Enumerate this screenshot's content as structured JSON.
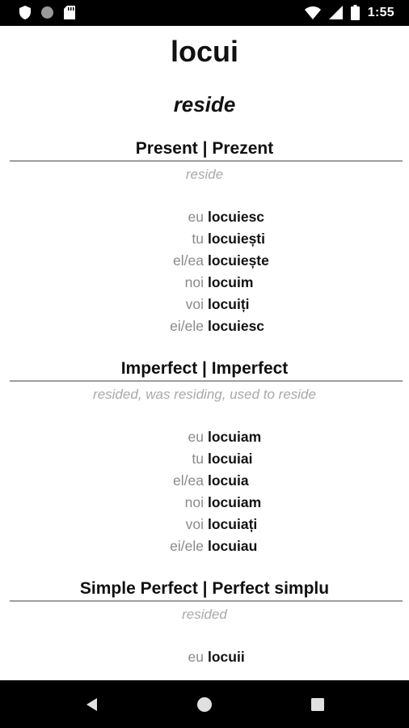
{
  "status_bar": {
    "time": "1:55",
    "left_icons": [
      "shield-icon",
      "circle-icon",
      "sd-card-icon"
    ],
    "right_icons": [
      "wifi-icon",
      "cellular-icon",
      "battery-icon"
    ]
  },
  "verb": {
    "title": "locui",
    "translation": "reside"
  },
  "tenses": [
    {
      "title": "Present | Prezent",
      "hint": "reside",
      "rows": [
        {
          "pronoun": "eu",
          "form": "locuiesc"
        },
        {
          "pronoun": "tu",
          "form": "locuiești"
        },
        {
          "pronoun": "el/ea",
          "form": "locuiește"
        },
        {
          "pronoun": "noi",
          "form": "locuim"
        },
        {
          "pronoun": "voi",
          "form": "locuiți"
        },
        {
          "pronoun": "ei/ele",
          "form": "locuiesc"
        }
      ]
    },
    {
      "title": "Imperfect | Imperfect",
      "hint": "resided, was residing, used to reside",
      "rows": [
        {
          "pronoun": "eu",
          "form": "locuiam"
        },
        {
          "pronoun": "tu",
          "form": "locuiai"
        },
        {
          "pronoun": "el/ea",
          "form": "locuia"
        },
        {
          "pronoun": "noi",
          "form": "locuiam"
        },
        {
          "pronoun": "voi",
          "form": "locuiați"
        },
        {
          "pronoun": "ei/ele",
          "form": "locuiau"
        }
      ]
    },
    {
      "title": "Simple Perfect | Perfect simplu",
      "hint": "resided",
      "rows": [
        {
          "pronoun": "eu",
          "form": "locuii"
        }
      ]
    }
  ],
  "nav_bar": {
    "buttons": [
      "back-icon",
      "home-icon",
      "recents-icon"
    ]
  }
}
